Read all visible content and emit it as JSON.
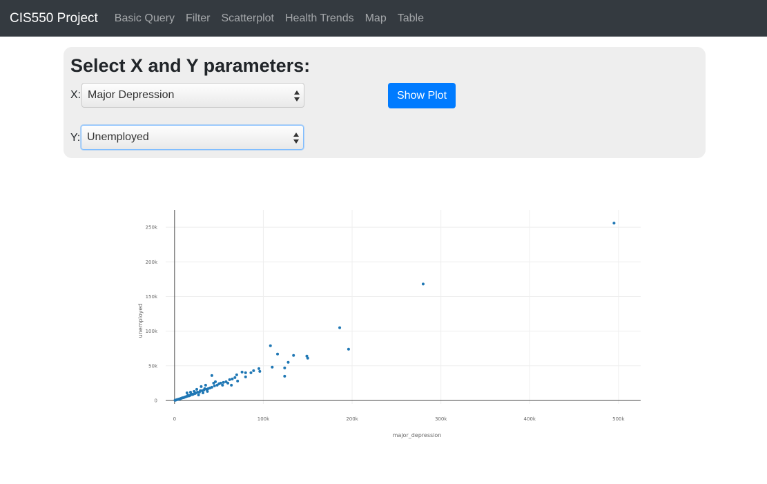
{
  "navbar": {
    "brand": "CIS550 Project",
    "links": [
      "Basic Query",
      "Filter",
      "Scatterplot",
      "Health Trends",
      "Map",
      "Table"
    ]
  },
  "panel": {
    "title": "Select X and Y parameters:",
    "x_label": "X:",
    "y_label": "Y:",
    "x_selected": "Major Depression",
    "y_selected": "Unemployed",
    "button_label": "Show Plot"
  },
  "colors": {
    "navbar_bg": "#343a40",
    "accent": "#007bff",
    "marker": "#1f77b4"
  },
  "chart_data": {
    "type": "scatter",
    "xlabel": "major_depression",
    "ylabel": "unemployed",
    "xlim": [
      -10000,
      525000
    ],
    "ylim": [
      -5000,
      275000
    ],
    "x_ticks": [
      0,
      100000,
      200000,
      300000,
      400000,
      500000
    ],
    "x_tick_labels": [
      "0",
      "100k",
      "200k",
      "300k",
      "400k",
      "500k"
    ],
    "y_ticks": [
      0,
      50000,
      100000,
      150000,
      200000,
      250000
    ],
    "y_tick_labels": [
      "0",
      "50k",
      "100k",
      "150k",
      "200k",
      "250k"
    ],
    "grid": true,
    "points": [
      [
        495000,
        256000
      ],
      [
        280000,
        168000
      ],
      [
        186000,
        105000
      ],
      [
        196000,
        74000
      ],
      [
        108000,
        79000
      ],
      [
        116000,
        67000
      ],
      [
        149000,
        64000
      ],
      [
        150000,
        61000
      ],
      [
        134000,
        65000
      ],
      [
        128000,
        55000
      ],
      [
        124000,
        47000
      ],
      [
        124000,
        35000
      ],
      [
        110000,
        48000
      ],
      [
        95000,
        46000
      ],
      [
        96000,
        42000
      ],
      [
        89000,
        43000
      ],
      [
        86000,
        40000
      ],
      [
        80000,
        40000
      ],
      [
        76000,
        41000
      ],
      [
        70000,
        37000
      ],
      [
        68000,
        33000
      ],
      [
        65000,
        31000
      ],
      [
        62000,
        30000
      ],
      [
        58000,
        27000
      ],
      [
        55000,
        26000
      ],
      [
        52000,
        25000
      ],
      [
        50000,
        24000
      ],
      [
        48000,
        22000
      ],
      [
        45000,
        21000
      ],
      [
        42000,
        19000
      ],
      [
        40000,
        18000
      ],
      [
        42000,
        36000
      ],
      [
        38000,
        17000
      ],
      [
        36000,
        16000
      ],
      [
        34000,
        17000
      ],
      [
        33000,
        15000
      ],
      [
        31000,
        14000
      ],
      [
        29000,
        14000
      ],
      [
        28000,
        12000
      ],
      [
        26000,
        12000
      ],
      [
        24000,
        11000
      ],
      [
        23000,
        10000
      ],
      [
        21000,
        9000
      ],
      [
        20000,
        8500
      ],
      [
        19000,
        9500
      ],
      [
        18000,
        8000
      ],
      [
        17000,
        7000
      ],
      [
        16000,
        6500
      ],
      [
        15000,
        7500
      ],
      [
        14000,
        6000
      ],
      [
        13000,
        5500
      ],
      [
        12000,
        5000
      ],
      [
        11000,
        4500
      ],
      [
        10000,
        4000
      ],
      [
        9000,
        3800
      ],
      [
        8000,
        3300
      ],
      [
        7000,
        2900
      ],
      [
        6000,
        2400
      ],
      [
        5000,
        2000
      ],
      [
        4000,
        1600
      ],
      [
        3000,
        1200
      ],
      [
        2000,
        800
      ],
      [
        1000,
        400
      ],
      [
        500,
        200
      ],
      [
        14000,
        11000
      ],
      [
        22000,
        13000
      ],
      [
        30000,
        20000
      ],
      [
        46000,
        27000
      ],
      [
        54000,
        22000
      ],
      [
        60000,
        25000
      ],
      [
        64000,
        22000
      ],
      [
        25000,
        16000
      ],
      [
        18000,
        12000
      ],
      [
        35000,
        22000
      ],
      [
        44000,
        25000
      ],
      [
        71000,
        28000
      ],
      [
        80000,
        34000
      ],
      [
        27000,
        8000
      ],
      [
        32000,
        11000
      ],
      [
        37000,
        13000
      ]
    ]
  }
}
